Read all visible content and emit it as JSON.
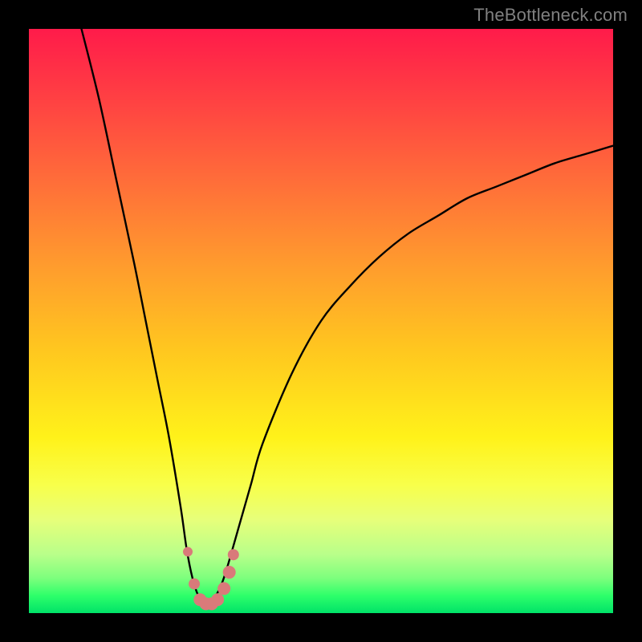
{
  "watermark": "TheBottleneck.com",
  "chart_data": {
    "type": "line",
    "title": "",
    "xlabel": "",
    "ylabel": "",
    "xlim": [
      0,
      100
    ],
    "ylim": [
      0,
      100
    ],
    "series": [
      {
        "name": "bottleneck-curve",
        "x": [
          9,
          12,
          15,
          18,
          20,
          22,
          24,
          26,
          27,
          28,
          29,
          30,
          31,
          32,
          33,
          34,
          36,
          38,
          40,
          45,
          50,
          55,
          60,
          65,
          70,
          75,
          80,
          85,
          90,
          95,
          100
        ],
        "y": [
          100,
          88,
          74,
          60,
          50,
          40,
          30,
          18,
          11,
          6,
          3,
          2,
          2,
          3,
          5,
          8,
          15,
          22,
          29,
          41,
          50,
          56,
          61,
          65,
          68,
          71,
          73,
          75,
          77,
          78.5,
          80
        ]
      }
    ],
    "markers": {
      "name": "highlight-dots",
      "color": "#d97a7a",
      "points": [
        {
          "x": 27.2,
          "y": 10.5,
          "r": 6
        },
        {
          "x": 28.3,
          "y": 5.0,
          "r": 7
        },
        {
          "x": 29.3,
          "y": 2.3,
          "r": 8
        },
        {
          "x": 30.3,
          "y": 1.6,
          "r": 8
        },
        {
          "x": 31.3,
          "y": 1.6,
          "r": 8
        },
        {
          "x": 32.3,
          "y": 2.3,
          "r": 8
        },
        {
          "x": 33.4,
          "y": 4.2,
          "r": 8
        },
        {
          "x": 34.3,
          "y": 7.0,
          "r": 8
        },
        {
          "x": 35.0,
          "y": 10.0,
          "r": 7
        }
      ]
    },
    "colors": {
      "curve": "#000000",
      "marker": "#d97a7a",
      "background_top": "#ff1b4a",
      "background_bottom": "#00e268",
      "frame": "#000000"
    }
  }
}
